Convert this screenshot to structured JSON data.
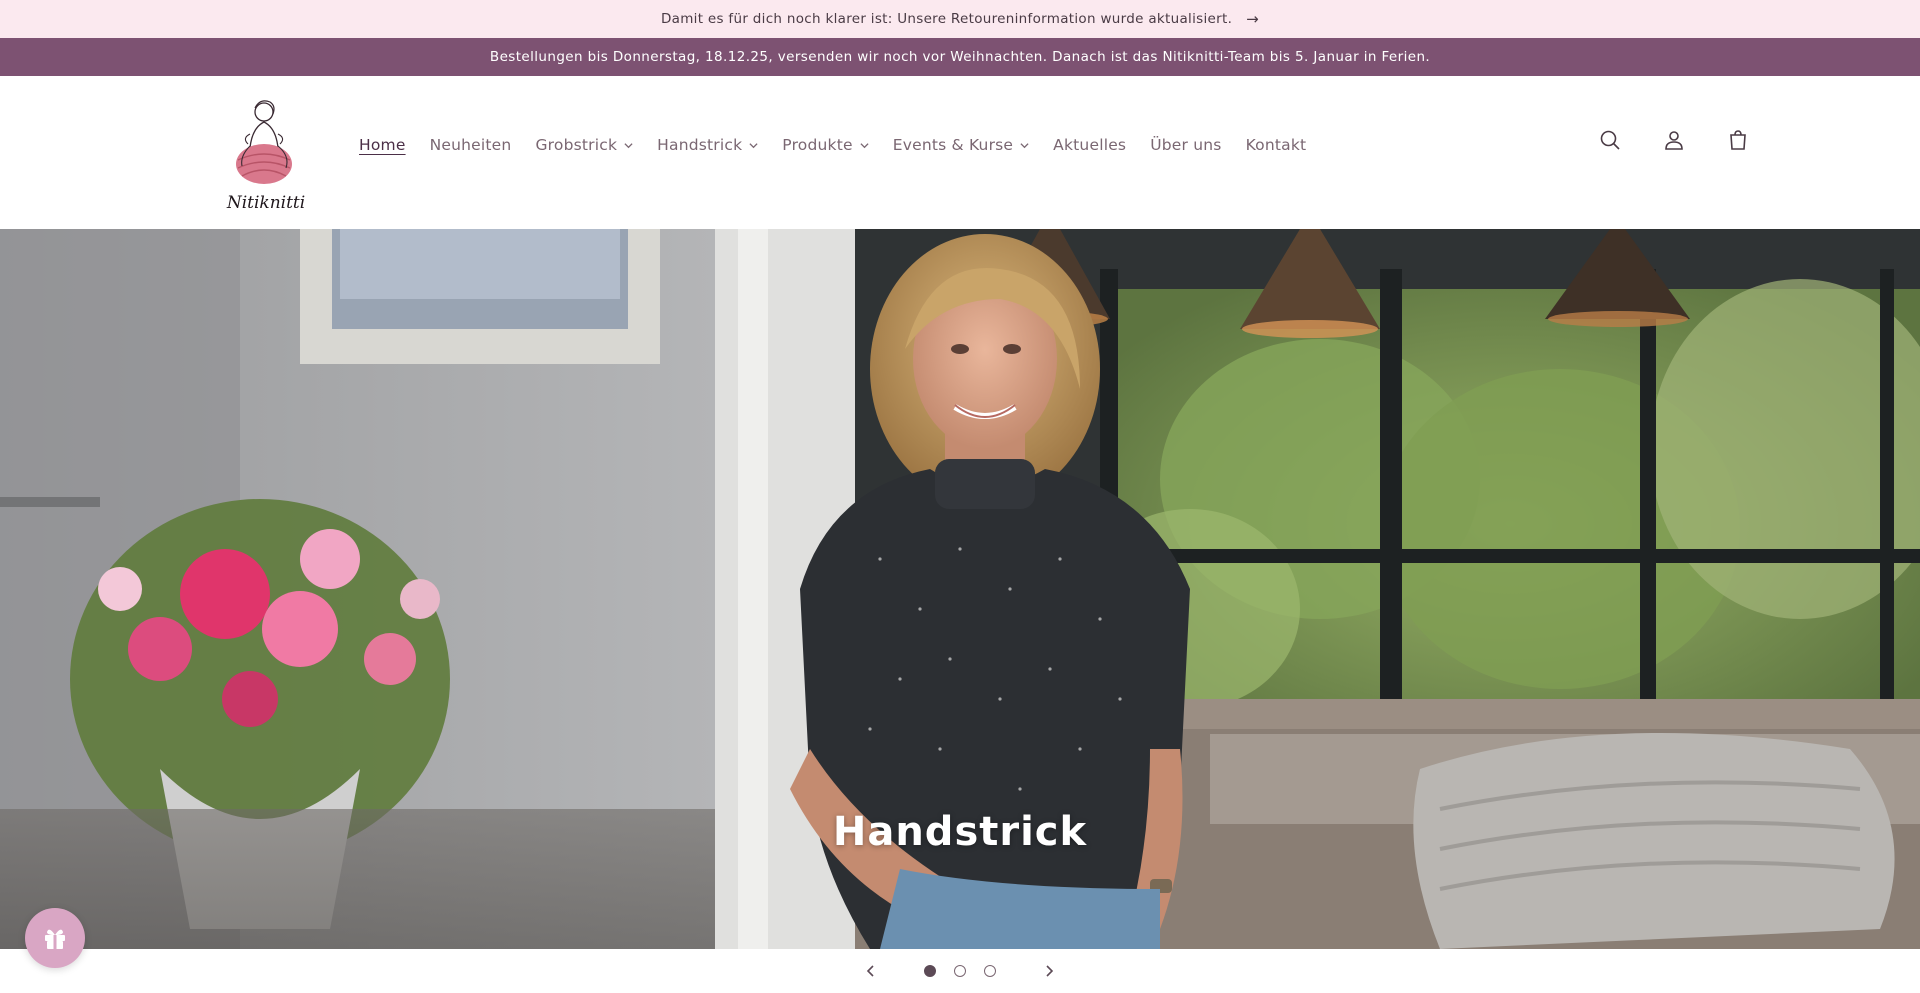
{
  "announcement": {
    "text": "Damit es für dich noch klarer ist: Unsere Retoureninformation wurde aktualisiert.",
    "arrow": "→"
  },
  "notice": {
    "text": "Bestellungen bis Donnerstag, 18.12.25, versenden wir noch vor Weihnachten. Danach ist das Nitiknitti-Team bis 5. Januar in Ferien."
  },
  "logo": {
    "text": "Nitiknitti"
  },
  "nav": {
    "items": [
      {
        "label": "Home",
        "active": true,
        "dropdown": false
      },
      {
        "label": "Neuheiten",
        "active": false,
        "dropdown": false
      },
      {
        "label": "Grobstrick",
        "active": false,
        "dropdown": true
      },
      {
        "label": "Handstrick",
        "active": false,
        "dropdown": true
      },
      {
        "label": "Produkte",
        "active": false,
        "dropdown": true
      },
      {
        "label": "Events & Kurse",
        "active": false,
        "dropdown": true
      },
      {
        "label": "Aktuelles",
        "active": false,
        "dropdown": false
      },
      {
        "label": "Über uns",
        "active": false,
        "dropdown": false
      },
      {
        "label": "Kontakt",
        "active": false,
        "dropdown": false
      }
    ]
  },
  "header_icons": [
    "search-icon",
    "account-icon",
    "cart-icon"
  ],
  "hero": {
    "title": "Handstrick"
  },
  "slider": {
    "prev": "‹",
    "next": "›",
    "slide_count": 3,
    "current_slide": 1
  },
  "colors": {
    "announce_bg": "#fbe9ef",
    "notice_bg": "#7d5272",
    "accent": "#7d5272",
    "gift_bubble": "#d9a6c4"
  }
}
